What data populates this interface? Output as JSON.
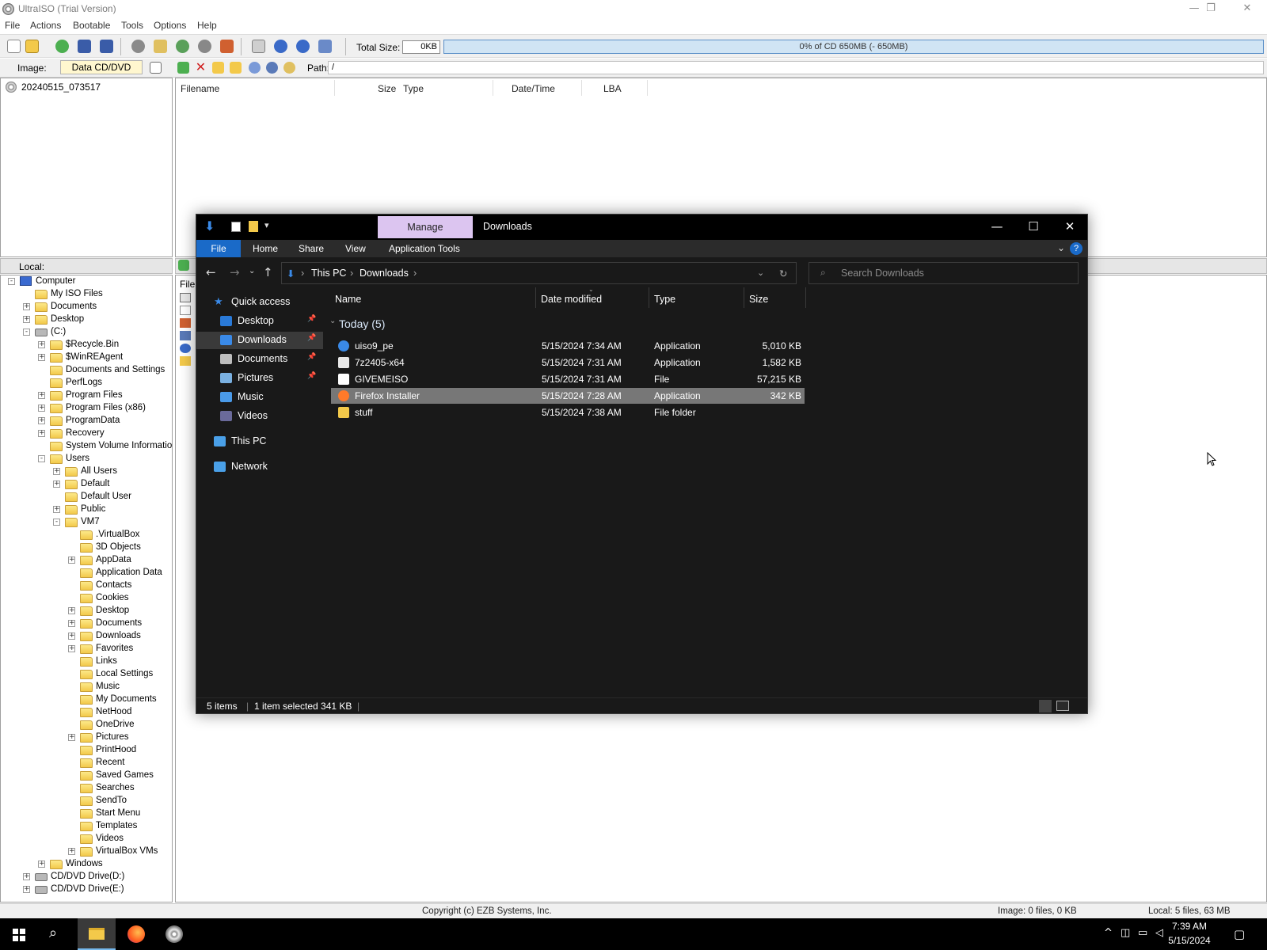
{
  "ultraiso": {
    "title": "UltraISO (Trial Version)",
    "controls": {
      "minimize": "—",
      "restore": "❐",
      "close": "✕"
    },
    "menu": [
      "File",
      "Actions",
      "Bootable",
      "Tools",
      "Options",
      "Help"
    ],
    "toolbar": {
      "total_size_label": "Total Size:",
      "total_size_value": "0KB",
      "capacity_text": "0% of CD 650MB (- 650MB)",
      "capacity_fill": 0
    },
    "image_bar": {
      "image_label": "Image:",
      "image_type": "Data CD/DVD",
      "path_label": "Path:",
      "path_value": "/"
    },
    "iso_tree": {
      "root": "20240515_073517"
    },
    "iso_list": {
      "columns": [
        "Filename",
        "Size",
        "Type",
        "Date/Time",
        "LBA"
      ]
    },
    "local_label": "Local:",
    "local_list_header": "Filen",
    "local_tree": [
      {
        "label": "Computer",
        "depth": 0,
        "type": "computer",
        "exp": "-"
      },
      {
        "label": "My ISO Files",
        "depth": 1,
        "type": "folder",
        "exp": ""
      },
      {
        "label": "Documents",
        "depth": 1,
        "type": "folder",
        "exp": "+"
      },
      {
        "label": "Desktop",
        "depth": 1,
        "type": "folder",
        "exp": "+"
      },
      {
        "label": "(C:)",
        "depth": 1,
        "type": "drive",
        "exp": "-"
      },
      {
        "label": "$Recycle.Bin",
        "depth": 2,
        "type": "folder",
        "exp": "+"
      },
      {
        "label": "$WinREAgent",
        "depth": 2,
        "type": "folder",
        "exp": "+"
      },
      {
        "label": "Documents and Settings",
        "depth": 2,
        "type": "folder",
        "exp": ""
      },
      {
        "label": "PerfLogs",
        "depth": 2,
        "type": "folder",
        "exp": ""
      },
      {
        "label": "Program Files",
        "depth": 2,
        "type": "folder",
        "exp": "+"
      },
      {
        "label": "Program Files (x86)",
        "depth": 2,
        "type": "folder",
        "exp": "+"
      },
      {
        "label": "ProgramData",
        "depth": 2,
        "type": "folder",
        "exp": "+"
      },
      {
        "label": "Recovery",
        "depth": 2,
        "type": "folder",
        "exp": "+"
      },
      {
        "label": "System Volume Information",
        "depth": 2,
        "type": "folder",
        "exp": ""
      },
      {
        "label": "Users",
        "depth": 2,
        "type": "folder",
        "exp": "-"
      },
      {
        "label": "All Users",
        "depth": 3,
        "type": "folder",
        "exp": "+"
      },
      {
        "label": "Default",
        "depth": 3,
        "type": "folder",
        "exp": "+"
      },
      {
        "label": "Default User",
        "depth": 3,
        "type": "folder",
        "exp": ""
      },
      {
        "label": "Public",
        "depth": 3,
        "type": "folder",
        "exp": "+"
      },
      {
        "label": "VM7",
        "depth": 3,
        "type": "folder",
        "exp": "-"
      },
      {
        "label": ".VirtualBox",
        "depth": 4,
        "type": "folder",
        "exp": ""
      },
      {
        "label": "3D Objects",
        "depth": 4,
        "type": "folder",
        "exp": ""
      },
      {
        "label": "AppData",
        "depth": 4,
        "type": "folder",
        "exp": "+"
      },
      {
        "label": "Application Data",
        "depth": 4,
        "type": "folder",
        "exp": ""
      },
      {
        "label": "Contacts",
        "depth": 4,
        "type": "folder",
        "exp": ""
      },
      {
        "label": "Cookies",
        "depth": 4,
        "type": "folder",
        "exp": ""
      },
      {
        "label": "Desktop",
        "depth": 4,
        "type": "folder",
        "exp": "+"
      },
      {
        "label": "Documents",
        "depth": 4,
        "type": "folder",
        "exp": "+"
      },
      {
        "label": "Downloads",
        "depth": 4,
        "type": "folder",
        "exp": "+"
      },
      {
        "label": "Favorites",
        "depth": 4,
        "type": "folder",
        "exp": "+"
      },
      {
        "label": "Links",
        "depth": 4,
        "type": "folder",
        "exp": ""
      },
      {
        "label": "Local Settings",
        "depth": 4,
        "type": "folder",
        "exp": ""
      },
      {
        "label": "Music",
        "depth": 4,
        "type": "folder",
        "exp": ""
      },
      {
        "label": "My Documents",
        "depth": 4,
        "type": "folder",
        "exp": ""
      },
      {
        "label": "NetHood",
        "depth": 4,
        "type": "folder",
        "exp": ""
      },
      {
        "label": "OneDrive",
        "depth": 4,
        "type": "folder",
        "exp": ""
      },
      {
        "label": "Pictures",
        "depth": 4,
        "type": "folder",
        "exp": "+"
      },
      {
        "label": "PrintHood",
        "depth": 4,
        "type": "folder",
        "exp": ""
      },
      {
        "label": "Recent",
        "depth": 4,
        "type": "folder",
        "exp": ""
      },
      {
        "label": "Saved Games",
        "depth": 4,
        "type": "folder",
        "exp": ""
      },
      {
        "label": "Searches",
        "depth": 4,
        "type": "folder",
        "exp": ""
      },
      {
        "label": "SendTo",
        "depth": 4,
        "type": "folder",
        "exp": ""
      },
      {
        "label": "Start Menu",
        "depth": 4,
        "type": "folder",
        "exp": ""
      },
      {
        "label": "Templates",
        "depth": 4,
        "type": "folder",
        "exp": ""
      },
      {
        "label": "Videos",
        "depth": 4,
        "type": "folder",
        "exp": ""
      },
      {
        "label": "VirtualBox VMs",
        "depth": 4,
        "type": "folder",
        "exp": "+"
      },
      {
        "label": "Windows",
        "depth": 2,
        "type": "folder",
        "exp": "+"
      },
      {
        "label": "CD/DVD Drive(D:)",
        "depth": 1,
        "type": "drive",
        "exp": "+"
      },
      {
        "label": "CD/DVD Drive(E:)",
        "depth": 1,
        "type": "drive",
        "exp": "+"
      }
    ],
    "status": {
      "copyright": "Copyright (c) EZB Systems, Inc.",
      "image": "Image: 0 files, 0 KB",
      "local": "Local: 5 files, 63 MB"
    }
  },
  "explorer": {
    "manage_tab": "Manage",
    "title": "Downloads",
    "controls": {
      "minimize": "—",
      "maximize": "☐",
      "close": "✕"
    },
    "ribbon_tabs": [
      "File",
      "Home",
      "Share",
      "View",
      "Application Tools"
    ],
    "breadcrumb": [
      "This PC",
      "Downloads"
    ],
    "search_placeholder": "Search Downloads",
    "nav": [
      {
        "label": "Quick access",
        "icon": "star-icon",
        "pinned": false
      },
      {
        "label": "Desktop",
        "icon": "desktop-icon",
        "pinned": true
      },
      {
        "label": "Downloads",
        "icon": "download-icon",
        "pinned": true,
        "selected": true
      },
      {
        "label": "Documents",
        "icon": "documents-icon",
        "pinned": true
      },
      {
        "label": "Pictures",
        "icon": "pictures-icon",
        "pinned": true
      },
      {
        "label": "Music",
        "icon": "music-icon",
        "pinned": false
      },
      {
        "label": "Videos",
        "icon": "videos-icon",
        "pinned": false
      },
      {
        "label": "This PC",
        "icon": "pc-icon",
        "pinned": false
      },
      {
        "label": "Network",
        "icon": "network-icon",
        "pinned": false
      }
    ],
    "columns": [
      "Name",
      "Date modified",
      "Type",
      "Size"
    ],
    "group": "Today (5)",
    "files": [
      {
        "name": "uiso9_pe",
        "date": "5/15/2024 7:34 AM",
        "type": "Application",
        "size": "5,010 KB",
        "icon": "uiso-app-icon"
      },
      {
        "name": "7z2405-x64",
        "date": "5/15/2024 7:31 AM",
        "type": "Application",
        "size": "1,582 KB",
        "icon": "7z-app-icon"
      },
      {
        "name": "GIVEMEISO",
        "date": "5/15/2024 7:31 AM",
        "type": "File",
        "size": "57,215 KB",
        "icon": "file-icon"
      },
      {
        "name": "Firefox Installer",
        "date": "5/15/2024 7:28 AM",
        "type": "Application",
        "size": "342 KB",
        "icon": "firefox-icon",
        "selected": true
      },
      {
        "name": "stuff",
        "date": "5/15/2024 7:38 AM",
        "type": "File folder",
        "size": "",
        "icon": "folder-icon"
      }
    ],
    "status": {
      "items": "5 items",
      "selected": "1 item selected  341 KB"
    }
  },
  "taskbar": {
    "time": "7:39 AM",
    "date": "5/15/2024"
  }
}
